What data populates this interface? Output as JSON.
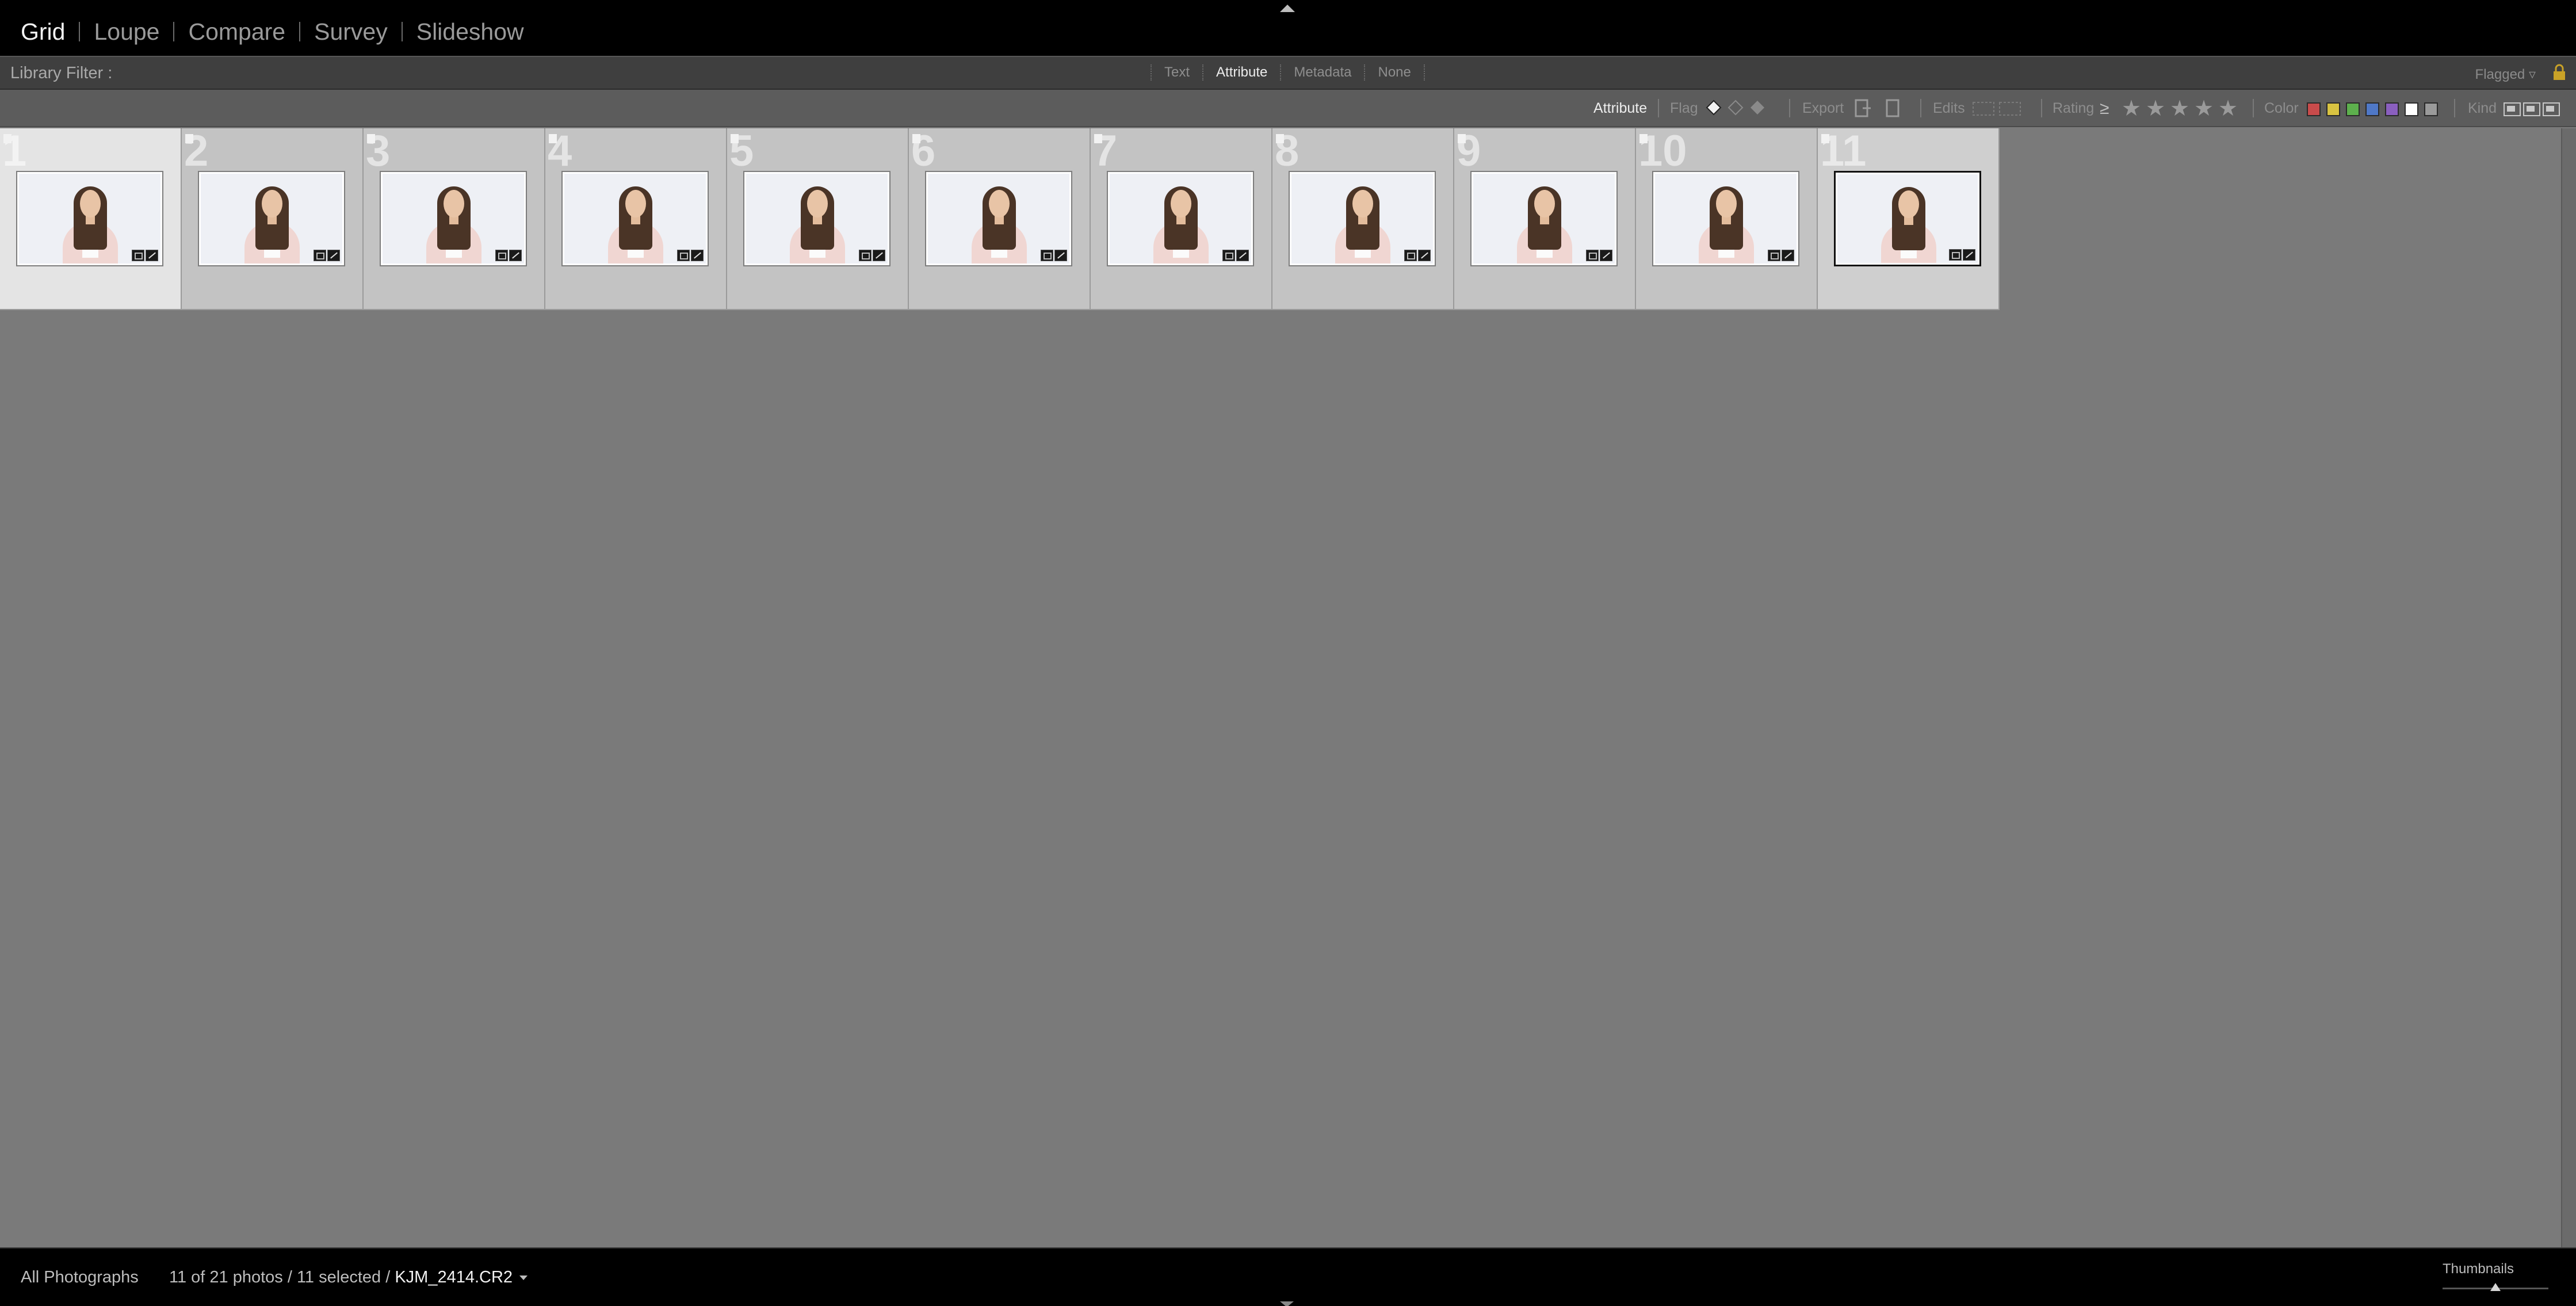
{
  "modules": [
    {
      "label": "Grid",
      "active": true
    },
    {
      "label": "Loupe",
      "active": false
    },
    {
      "label": "Compare",
      "active": false
    },
    {
      "label": "Survey",
      "active": false
    },
    {
      "label": "Slideshow",
      "active": false
    }
  ],
  "filter": {
    "label": "Library Filter :",
    "tabs": [
      "Text",
      "Attribute",
      "Metadata",
      "None"
    ],
    "active_tab": "Attribute",
    "preset": "Flagged"
  },
  "attributes": {
    "title": "Attribute",
    "flag_label": "Flag",
    "export_label": "Export",
    "edits_label": "Edits",
    "rating_label": "Rating",
    "rating_op": "≥",
    "stars": 5,
    "color_label": "Color",
    "colors": [
      "#c94b4b",
      "#d8c341",
      "#5db04d",
      "#4f78c7",
      "#8a5fbf",
      "#ffffff",
      "#9a9a9a"
    ],
    "kind_label": "Kind"
  },
  "grid": {
    "cells": [
      {
        "index": "1"
      },
      {
        "index": "2"
      },
      {
        "index": "3"
      },
      {
        "index": "4"
      },
      {
        "index": "5"
      },
      {
        "index": "6"
      },
      {
        "index": "7"
      },
      {
        "index": "8"
      },
      {
        "index": "9"
      },
      {
        "index": "10"
      },
      {
        "index": "11"
      }
    ],
    "selected_index": "11"
  },
  "status": {
    "source": "All Photographs",
    "count": "11 of 21 photos / 11 selected /",
    "filename": "KJM_2414.CR2",
    "thumbnails_label": "Thumbnails",
    "thumbnail_size": 0.5
  }
}
